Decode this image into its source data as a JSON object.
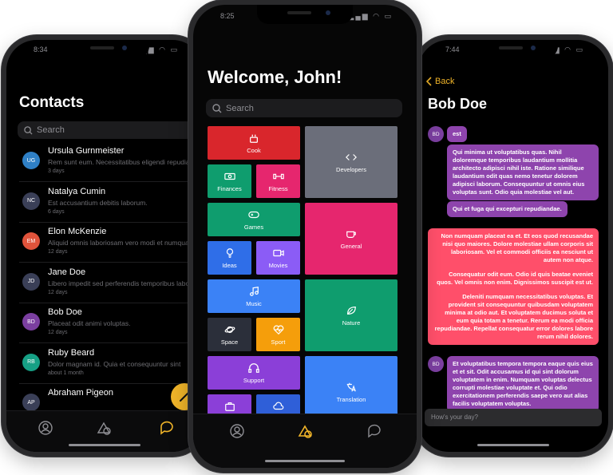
{
  "left_phone": {
    "status_time": "8:34",
    "title": "Contacts",
    "search_placeholder": "Search",
    "contacts": [
      {
        "initials": "UG",
        "name": "Ursula Gurnmeister",
        "message": "Rem sunt eum. Necessitatibus eligendi repudiandae",
        "when": "3 days",
        "color": "#2f80c6"
      },
      {
        "initials": "NC",
        "name": "Natalya Cumin",
        "message": "Est accusantium debitis laborum.",
        "when": "6 days",
        "color": "#3a3f57"
      },
      {
        "initials": "EM",
        "name": "Elon McKenzie",
        "message": "Aliquid omnis laboriosam vero modi et numquam",
        "when": "12 days",
        "color": "#e0533b"
      },
      {
        "initials": "JD",
        "name": "Jane Doe",
        "message": "Libero impedit sed perferendis temporibus laborum",
        "when": "12 days",
        "color": "#3a3f57"
      },
      {
        "initials": "BD",
        "name": "Bob Doe",
        "message": "Placeat odit animi voluptas.",
        "when": "12 days",
        "color": "#7b3fa0"
      },
      {
        "initials": "RB",
        "name": "Ruby Beard",
        "message": "Dolor magnam id. Quia et consequuntur sint",
        "when": "about 1 month",
        "color": "#16a085"
      },
      {
        "initials": "AP",
        "name": "Abraham Pigeon",
        "message": "",
        "when": "",
        "color": "#3a3f57"
      }
    ]
  },
  "center_phone": {
    "status_time": "8:25",
    "title": "Welcome, John!",
    "search_placeholder": "Search",
    "categories": [
      {
        "label": "Cook",
        "icon": "cook-icon",
        "color": "#d9262c"
      },
      {
        "label": "Developers",
        "icon": "code-icon",
        "color": "#6b6e7a"
      },
      {
        "label": "Finances",
        "icon": "money-icon",
        "color": "#0f9d6e"
      },
      {
        "label": "Fitness",
        "icon": "dumbbell-icon",
        "color": "#e6266e"
      },
      {
        "label": "Games",
        "icon": "gamepad-icon",
        "color": "#0f9d6e"
      },
      {
        "label": "General",
        "icon": "coffee-icon",
        "color": "#e6266e"
      },
      {
        "label": "Ideas",
        "icon": "lightbulb-icon",
        "color": "#2f6ee8"
      },
      {
        "label": "Movies",
        "icon": "video-icon",
        "color": "#8b5cf6"
      },
      {
        "label": "Music",
        "icon": "music-icon",
        "color": "#3b82f6"
      },
      {
        "label": "Nature",
        "icon": "leaf-icon",
        "color": "#0f9d6e"
      },
      {
        "label": "Space",
        "icon": "planet-icon",
        "color": "#2b2f3a"
      },
      {
        "label": "Sport",
        "icon": "heartbeat-icon",
        "color": "#f59e0b"
      },
      {
        "label": "Support",
        "icon": "headphones-icon",
        "color": "#8b3fd8"
      },
      {
        "label": "Translation",
        "icon": "translate-icon",
        "color": "#3b82f6"
      },
      {
        "label": "Travel",
        "icon": "suitcase-icon",
        "color": "#8b3fd8"
      },
      {
        "label": "Weather",
        "icon": "cloud-icon",
        "color": "#2f5fd8"
      }
    ]
  },
  "right_phone": {
    "status_time": "7:44",
    "back_label": "Back",
    "title": "Bob Doe",
    "avatar_initials": "BD",
    "messages": [
      {
        "text": "est"
      },
      {
        "text": "Qui minima ut voluptatibus quas. Nihil doloremque temporibus laudantium mollitia architecto adipisci nihil iste. Ratione similique laudantium odit quas nemo tenetur dolorem adipisci laborum. Consequuntur ut omnis eius voluptas sunt. Odio quia molestiae vel aut."
      },
      {
        "text": "Qui et fuga qui excepturi repudiandae."
      },
      {
        "text": "Non numquam placeat ea et. Et eos quod recusandae nisi quo maiores. Dolore molestiae ullam corporis sit laboriosam. Vel et commodi officiis ea nesciunt ut autem non atque."
      },
      {
        "text": "Consequatur odit eum. Odio id quis beatae eveniet quos. Vel omnis non enim. Dignissimos suscipit est ut."
      },
      {
        "text": "Deleniti numquam necessitatibus voluptas. Et provident sit consequuntur quibusdam voluptatem minima at odio aut. Et voluptatem ducimus soluta et eum quia totam a tenetur. Rerum ea modi officia repudiandae. Repellat consequatur error dolores labore rerum nihil dolores."
      },
      {
        "text": "Et voluptatibus tempora tempora eaque quis eius et et sit. Odit accusamus id qui sint dolorum voluptatem in enim. Numquam voluptas delectus corrupti molestiae voluptate et. Qui odio exercitationem perferendis saepe vero aut alias facilis voluptatem voluptas."
      }
    ],
    "composer_placeholder": "How's your day?"
  },
  "colors": {
    "accent": "#f0b429",
    "chat_purple": "#8e44ad",
    "chat_red": "#ff4f6a"
  }
}
